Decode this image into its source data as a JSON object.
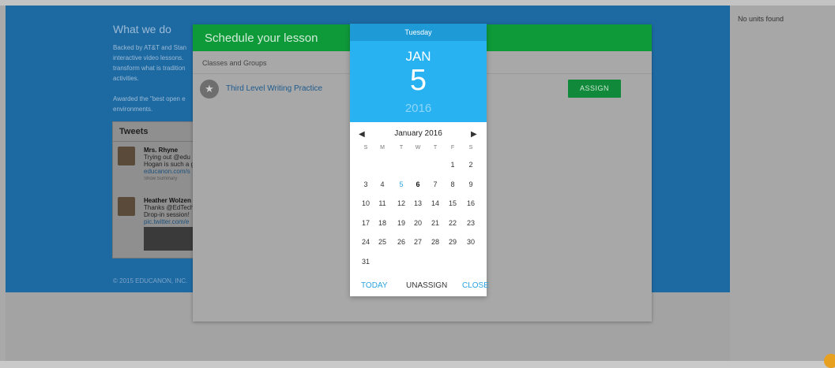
{
  "right_panel": {
    "no_units": "No units found"
  },
  "background": {
    "title": "What we do",
    "para1": [
      "Backed by AT&T and Stan",
      "interactive video lessons.",
      "transform what is tradition",
      "activities."
    ],
    "para2": [
      "Awarded the \"best open e",
      "environments."
    ],
    "tweets": {
      "header": "Tweets",
      "items": [
        {
          "name": "Mrs. Rhyne",
          "lines": [
            "Trying out @edu",
            "Hogan is such a g",
            "educanon.com/s"
          ],
          "meta": "Show Summary"
        },
        {
          "name": "Heather Wolzen",
          "lines": [
            "Thanks @EdTech",
            "Drop-in session!",
            "pic.twitter.com/e"
          ],
          "meta": ""
        }
      ]
    },
    "footer": "© 2015 EDUCANON, INC."
  },
  "modal": {
    "title": "Schedule your lesson",
    "subtitle": "Classes and Groups",
    "class_name": "Third Level Writing Practice",
    "assign_label": "ASSIGN",
    "colors": {
      "header": "#0f9a3a",
      "assign": "#108a3a"
    }
  },
  "datepicker": {
    "weekday": "Tuesday",
    "month_short": "JAN",
    "day": "5",
    "year": "2016",
    "calendar_title": "January 2016",
    "prev_icon": "◀",
    "next_icon": "▶",
    "dow": [
      "S",
      "M",
      "T",
      "W",
      "T",
      "F",
      "S"
    ],
    "weeks": [
      [
        "",
        "",
        "",
        "",
        "",
        "1",
        "2"
      ],
      [
        "3",
        "4",
        "5",
        "6",
        "7",
        "8",
        "9"
      ],
      [
        "10",
        "11",
        "12",
        "13",
        "14",
        "15",
        "16"
      ],
      [
        "17",
        "18",
        "19",
        "20",
        "21",
        "22",
        "23"
      ],
      [
        "24",
        "25",
        "26",
        "27",
        "28",
        "29",
        "30"
      ],
      [
        "31",
        "",
        "",
        "",
        "",
        "",
        ""
      ]
    ],
    "highlight_today": "5",
    "selected": "6",
    "buttons": {
      "today": "TODAY",
      "unassign": "UNASSIGN",
      "close": "CLOSE"
    },
    "colors": {
      "header": "#1e9ad6",
      "body": "#29b2f1",
      "accent": "#29a3e0"
    }
  }
}
